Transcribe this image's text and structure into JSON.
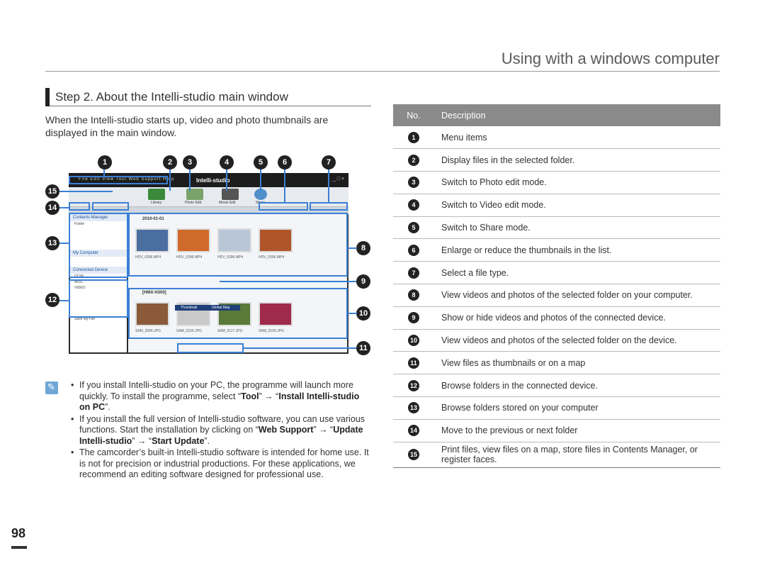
{
  "header": {
    "title": "Using with a windows computer"
  },
  "step": {
    "title": "Step 2. About the Intelli-studio main window"
  },
  "intro": "When the Intelli-studio starts up, video and photo thumbnails are displayed in the main window.",
  "callouts": [
    "1",
    "2",
    "3",
    "4",
    "5",
    "6",
    "7",
    "8",
    "9",
    "10",
    "11",
    "12",
    "13",
    "14",
    "15"
  ],
  "screenshot": {
    "menu": "File  Edit  View  Tool  Web Support  Help",
    "logo": "Intelli-studio",
    "tools": [
      "Library",
      "Photo Edit",
      "Movie Edit",
      "Share"
    ],
    "left_panel": {
      "contents_manager": "Contents Manager",
      "folder": "Folder",
      "my_computer": "My Computer",
      "connected_device": "Connected Device",
      "dcim": "DCIM",
      "misc": "MISC",
      "video": "VIDEO",
      "save_file": "Save My File"
    },
    "date_label": "2010-01-01",
    "device_label": "[HMX-H300]",
    "top_files": [
      "HDV_0396.MP4",
      "HDV_0396.MP4",
      "HDV_0396.MP4",
      "HDV_0396.MP4"
    ],
    "bottom_files": [
      "SAM_2096.JPG",
      "SAM_0106.JPG",
      "SAM_0117.JPG",
      "SAM_0106.JPG"
    ],
    "tabs": [
      "Thumbnail",
      "Global Map"
    ],
    "colors": {
      "accent": "#3a7fd5"
    }
  },
  "notes": {
    "b1_p1": "If you install Intelli-studio on your PC, the programme will launch more quickly. To install the programme, select “",
    "b1_tool": "Tool",
    "b1_arrow": "” → “",
    "b1_install": "Install Intelli-studio on PC",
    "b1_end": "”.",
    "b2_p1": "If you install the full version of Intelli-studio software, you can use various functions. Start the installation by clicking on “",
    "b2_web": "Web Support",
    "b2_arrow1": "” → “",
    "b2_update": "Update Intelli-studio",
    "b2_arrow2": "” → “",
    "b2_start": "Start Update",
    "b2_end": "”.",
    "b3": "The camcorder’s built-in Intelli-studio software is intended for home use. It is not for precision or industrial productions. For these applications, we recommend an editing software designed for professional use."
  },
  "table": {
    "headers": [
      "No.",
      "Description"
    ],
    "rows": [
      {
        "no": "1",
        "desc": "Menu items"
      },
      {
        "no": "2",
        "desc": "Display files in the selected folder."
      },
      {
        "no": "3",
        "desc": "Switch to Photo edit mode."
      },
      {
        "no": "4",
        "desc": "Switch to Video edit mode."
      },
      {
        "no": "5",
        "desc": "Switch to Share mode."
      },
      {
        "no": "6",
        "desc": "Enlarge or reduce the thumbnails in the list."
      },
      {
        "no": "7",
        "desc": "Select a file type."
      },
      {
        "no": "8",
        "desc": "View videos and photos of the selected folder on your computer."
      },
      {
        "no": "9",
        "desc": "Show or hide videos and photos of the connected device."
      },
      {
        "no": "10",
        "desc": "View videos and photos of the selected folder on the device."
      },
      {
        "no": "11",
        "desc": "View files as thumbnails or on a map"
      },
      {
        "no": "12",
        "desc": "Browse folders in the connected device."
      },
      {
        "no": "13",
        "desc": "Browse folders stored on your computer"
      },
      {
        "no": "14",
        "desc": "Move to the previous or next folder"
      },
      {
        "no": "15",
        "desc": "Print files, view files on a map, store files in Contents Manager, or register faces."
      }
    ]
  },
  "page_number": "98"
}
